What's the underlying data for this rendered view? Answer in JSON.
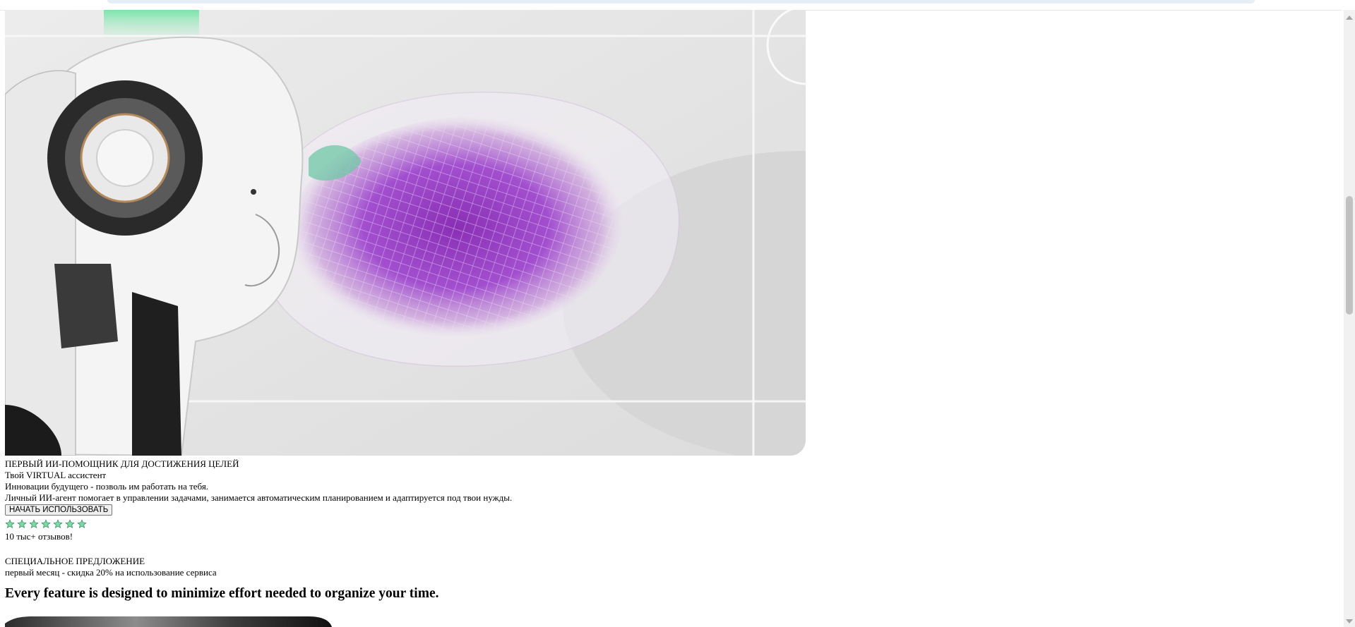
{
  "hero": {
    "image_alt": "AI robot head with a glowing purple wireframe brain"
  },
  "intro": {
    "tagline": "ПЕРВЫЙ ИИ-ПОМОЩНИК ДЛЯ ДОСТИЖЕНИЯ ЦЕЛЕЙ",
    "title": "Твой VIRTUAL ассистент",
    "subtitle": "Инновации будущего - позволь им работать на тебя.",
    "description": "Личный ИИ-агент помогает в управлении задачами, занимается автоматическим планированием и адаптируется под твои нужды.",
    "cta_label": "НАЧАТЬ ИСПОЛЬЗОВАТЬ"
  },
  "rating": {
    "stars": 7,
    "star_icon": "star-icon",
    "star_color": "#7ed9a6",
    "reviews_text": "10 тыс+ отзывов!"
  },
  "offer": {
    "title": "СПЕЦИАЛЬНОЕ ПРЕДЛОЖЕНИЕ",
    "text": "первый месяц - скидка 20% на использование сервиса"
  },
  "features": {
    "headline": "Every feature is designed to minimize effort needed to organize your time."
  },
  "colors": {
    "accent_purple": "#9b3fc2",
    "accent_green": "#7ed9a6"
  }
}
